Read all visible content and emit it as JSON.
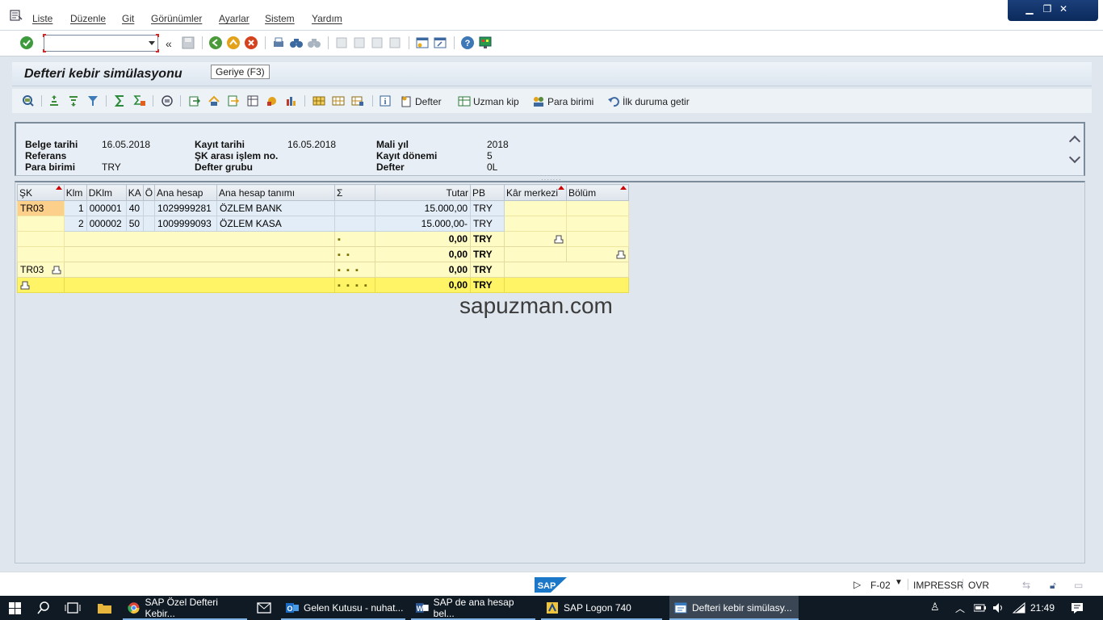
{
  "menu": {
    "items": [
      "Liste",
      "Düzenle",
      "Git",
      "Görünümler",
      "Ayarlar",
      "Sistem",
      "Yardım"
    ]
  },
  "toolbar": {
    "command_value": "",
    "collapse_label": "«"
  },
  "title": {
    "text": "Defteri kebir simülasyonu",
    "tooltip": "Geriye    (F3)"
  },
  "app_toolbar": {
    "defter": "Defter",
    "uzman_kip": "Uzman kip",
    "para_birimi": "Para birimi",
    "ilk_duruma": "İlk duruma getir"
  },
  "header": {
    "belge_tarihi_label": "Belge tarihi",
    "belge_tarihi": "16.05.2018",
    "referans_label": "Referans",
    "para_birimi_label": "Para birimi",
    "para_birimi": "TRY",
    "kayit_tarihi_label": "Kayıt tarihi",
    "kayit_tarihi": "16.05.2018",
    "sk_arasi_label": "ŞK arası işlem no.",
    "defter_grubu_label": "Defter grubu",
    "mali_yil_label": "Mali yıl",
    "mali_yil": "2018",
    "kayit_donemi_label": "Kayıt dönemi",
    "kayit_donemi": "5",
    "defter_label": "Defter",
    "defter": "0L"
  },
  "grid": {
    "columns": [
      "ŞK",
      "Klm",
      "DKlm",
      "KA",
      "Ö",
      "Ana hesap",
      "Ana hesap tanımı",
      "Σ",
      "Tutar",
      "PB",
      "Kâr merkezi",
      "Bölüm"
    ],
    "sk": "TR03",
    "rows": [
      {
        "klm": "1",
        "dklm": "000001",
        "ka": "40",
        "o": "",
        "hesap": "1029999281",
        "tanim": "ÖZLEM BANK",
        "tutar": "15.000,00",
        "pb": "TRY"
      },
      {
        "klm": "2",
        "dklm": "000002",
        "ka": "50",
        "o": "",
        "hesap": "1009999093",
        "tanim": "ÖZLEM KASA",
        "tutar": "15.000,00-",
        "pb": "TRY"
      }
    ],
    "subtotals": [
      {
        "dots": "▪",
        "tutar": "0,00",
        "pb": "TRY"
      },
      {
        "dots": "▪ ▪",
        "tutar": "0,00",
        "pb": "TRY"
      },
      {
        "sk": "TR03",
        "dots": "▪ ▪ ▪",
        "tutar": "0,00",
        "pb": "TRY"
      },
      {
        "dots": "▪ ▪ ▪ ▪",
        "tutar": "0,00",
        "pb": "TRY"
      }
    ]
  },
  "watermark": "sapuzman.com",
  "status": {
    "system": "F-02",
    "server": "IMPRESSR",
    "mode": "OVR"
  },
  "taskbar": {
    "items": [
      "SAP Özel Defteri Kebir...",
      "Gelen Kutusu - nuhat...",
      "SAP de ana hesap bel...",
      "SAP Logon 740",
      "Defteri kebir simülasy..."
    ],
    "clock": "21:49"
  },
  "colors": {
    "yellow_row": "#fffbc4",
    "yellow_total": "#fff466",
    "selected_cell": "#fccf8a",
    "title_bg": "#dce6f0"
  }
}
